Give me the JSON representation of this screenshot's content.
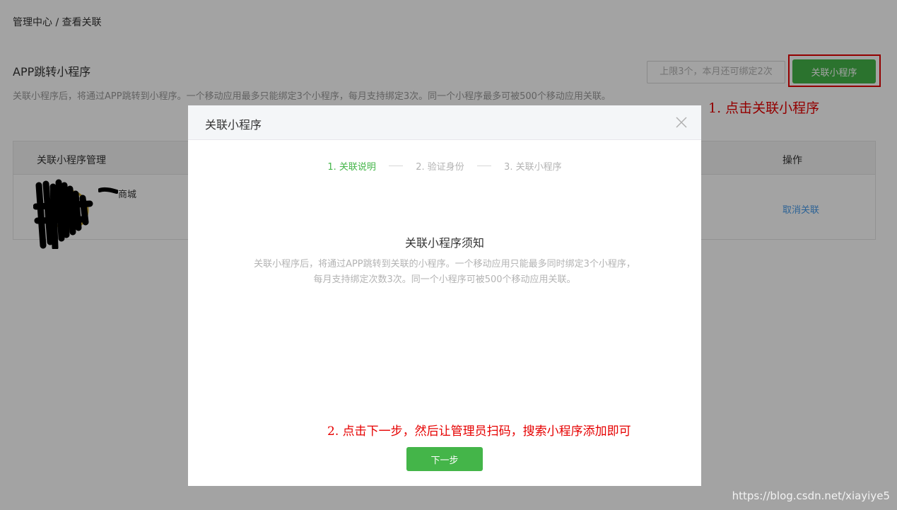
{
  "breadcrumb": "管理中心 / 查看关联",
  "section": {
    "title": "APP跳转小程序",
    "description": "关联小程序后，将通过APP跳转到小程序。一个移动应用最多只能绑定3个小程序，每月支持绑定3次。同一个小程序最多可被500个移动应用关联。",
    "limit_text": "上限3个，本月还可绑定2次",
    "bind_button": "关联小程序"
  },
  "annotations": {
    "step1": "1. 点击关联小程序",
    "step2": "2. 点击下一步，然后让管理员扫码，搜索小程序添加即可"
  },
  "table": {
    "headers": {
      "name": "关联小程序管理",
      "operation": "操作"
    },
    "rows": [
      {
        "name": "商城",
        "action": "取消关联"
      }
    ]
  },
  "modal": {
    "title": "关联小程序",
    "steps": [
      "1. 关联说明",
      "2. 验证身份",
      "3. 关联小程序"
    ],
    "active_step": 0,
    "notice_title": "关联小程序须知",
    "notice_text": "关联小程序后，将通过APP跳转到关联的小程序。一个移动应用只能最多同时绑定3个小程序，每月支持绑定次数3次。同一个小程序可被500个移动应用关联。",
    "next_button": "下一步"
  },
  "watermark": "https://blog.csdn.net/xiayiye5",
  "colors": {
    "primary_green": "#44b549",
    "annotation_red": "#e60000",
    "link_blue": "#459ae9"
  },
  "icons": [
    "close-icon"
  ]
}
